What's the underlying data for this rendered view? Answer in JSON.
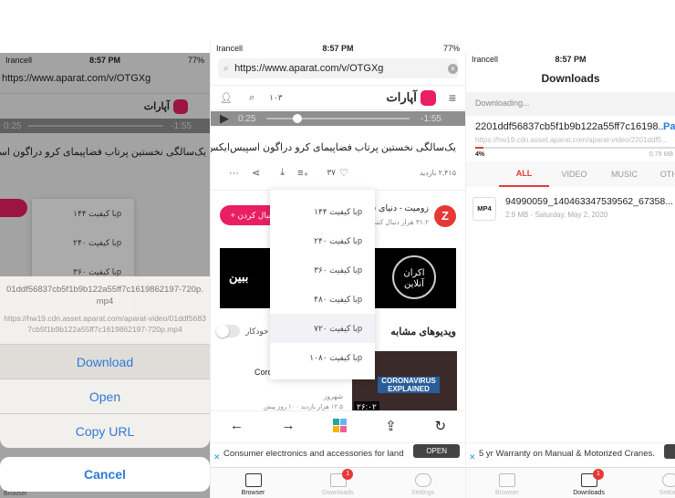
{
  "status": {
    "carrier": "Irancell",
    "time": "8:57 PM",
    "battery": "77%"
  },
  "browser": {
    "url": "https://www.aparat.com/v/OTGXg",
    "site_name": "آپارات",
    "counter": "۱۰۳",
    "player": {
      "elapsed": "0:25",
      "remaining": "-1:55",
      "progress": 0.18
    },
    "video_title": "یک‌سالگی نخستین پرتاب فضاپیمای کرو دراگون اسپیس‌ایکس",
    "views": "۲,۴۱۵ بازدید",
    "likes": "۳۷",
    "channel_name": "زومیت - دنیای ف",
    "channel_followers": "۳۱.۲ هزار دنبال کنند",
    "follow_label": "+ دنبال کردن",
    "quality_options": [
      "با کیفیت ۱۴۴p",
      "با کیفیت ۲۴۰p",
      "با کیفیت ۳۶۰p",
      "با کیفیت ۴۸۰p",
      "با کیفیت ۷۲۰p",
      "با کیفیت ۱۰۸۰p"
    ],
    "selected_quality": "با کیفیت ۷۲۰p",
    "banner_text_left": "ببین",
    "banner_logo": "اکران آنلاین",
    "similar_title": "ویدیوهای مشابه",
    "autoplay_label": "خودکار",
    "autoplay_on": false,
    "similar_item": {
      "title_frag": "Coro",
      "channel": "شهروز",
      "meta": "۱۲.۵ هزار بازدید · ۱۰ روز پیش",
      "thumb_text": "CORONAVIRUS EXPLAINED",
      "duration": "۲۶:۰۲"
    },
    "ad_text": "Consumer electronics and accessories for land",
    "ad_button": "OPEN"
  },
  "action_sheet": {
    "file_name": "01ddf56837cb5f1b9b122a55ff7c1619862197-720p.mp4",
    "file_url": "https://hw19.cdn.asset.aparat.com/aparat-video/01ddf56837cb5f1b9b122a55ff7c1619862197-720p.mp4",
    "actions": [
      "Download",
      "Open",
      "Copy URL"
    ],
    "cancel": "Cancel"
  },
  "downloads": {
    "title": "Downloads",
    "section_label": "Downloading...",
    "active": {
      "name": "2201ddf56837cb5f1b9b122a55ff7c16198...",
      "url": "https://hw19.cdn.asset.aparat.com/aparat-video/2201ddf5...",
      "percent": "4%",
      "progress": 0.04,
      "size": "0.79 MB",
      "action": "Pause"
    },
    "filters": [
      "ALL",
      "VIDEO",
      "MUSIC",
      "OTHER"
    ],
    "active_filter": "ALL",
    "items": [
      {
        "type": "MP4",
        "name": "94990059_140463347539562_67358...",
        "meta": "2.9 MB - Saturday, May 2, 2020"
      }
    ],
    "ad_text": "5 yr Warranty on Manual & Motorized Cranes."
  },
  "tabbar": {
    "tabs": [
      "Browser",
      "Downloads",
      "Settings"
    ],
    "downloads_badge": "1"
  },
  "colors": {
    "accent": "#e91e63",
    "link": "#2f7ad8",
    "progress": "#e53935"
  }
}
